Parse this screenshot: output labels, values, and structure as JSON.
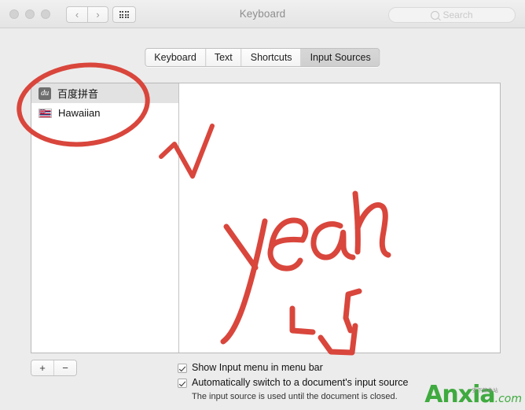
{
  "window": {
    "title": "Keyboard",
    "traffic_lights": [
      "close",
      "minimize",
      "zoom"
    ],
    "nav_back": "‹",
    "nav_forward": "›"
  },
  "search": {
    "placeholder": "Search",
    "value": ""
  },
  "tabs": [
    {
      "label": "Keyboard",
      "selected": false
    },
    {
      "label": "Text",
      "selected": false
    },
    {
      "label": "Shortcuts",
      "selected": false
    },
    {
      "label": "Input Sources",
      "selected": true
    }
  ],
  "input_sources": [
    {
      "label": "百度拼音",
      "icon": "baidu-pinyin-icon",
      "icon_text": "du",
      "selected": true
    },
    {
      "label": "Hawaiian",
      "icon": "hawaiian-flag-icon",
      "icon_text": "",
      "selected": false
    }
  ],
  "list_controls": {
    "add_label": "+",
    "remove_label": "−"
  },
  "options": [
    {
      "label": "Show Input menu in menu bar",
      "checked": true
    },
    {
      "label": "Automatically switch to a document's input source",
      "checked": true
    }
  ],
  "option_note": "The input source is used until the document is closed.",
  "watermark": {
    "brand": "Anxia",
    "tld": ".com",
    "subtitle": "安下软件站"
  },
  "annotations": {
    "ink_color": "#d9463c",
    "circle_note": "red ellipse around the input source list",
    "handwriting": "yeah",
    "check_mark": "red check mark"
  },
  "colors": {
    "window_bg": "#ececec",
    "titlebar_top": "#f0f0f0",
    "titlebar_bottom": "#e4e4e4",
    "panel_bg": "#ffffff",
    "selected_row": "#e2e2e2",
    "ink_red": "#d9463c",
    "watermark_green": "#3faa3f"
  }
}
